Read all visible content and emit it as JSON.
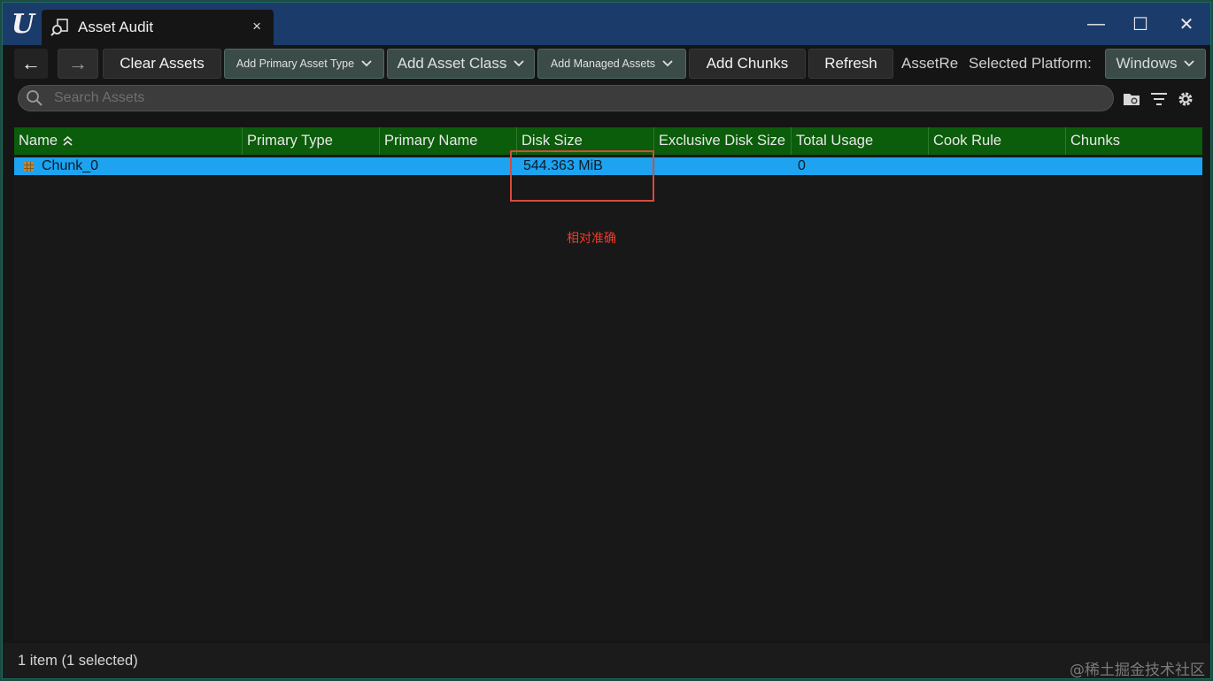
{
  "window": {
    "tab_title": "Asset Audit",
    "tab_close": "×",
    "controls": {
      "minimize": "—",
      "maximize": "☐",
      "close": "✕"
    }
  },
  "toolbar": {
    "back": "←",
    "forward": "→",
    "clear_assets": "Clear Assets",
    "add_primary_asset_type": "Add Primary Asset Type",
    "add_asset_class": "Add Asset Class",
    "add_managed_assets": "Add Managed Assets",
    "add_chunks": "Add Chunks",
    "refresh": "Refresh",
    "asset_registry_truncated": "AssetRe",
    "selected_platform_label": "Selected Platform:",
    "platform_value": "Windows"
  },
  "search": {
    "placeholder": "Search Assets",
    "value": ""
  },
  "table": {
    "columns": [
      "Name",
      "Primary Type",
      "Primary Name",
      "Disk Size",
      "Exclusive Disk Size",
      "Total Usage",
      "Cook Rule",
      "Chunks"
    ],
    "rows": [
      {
        "name": "Chunk_0",
        "primary_type": "",
        "primary_name": "",
        "disk_size": "544.363 MiB",
        "exclusive_disk_size": "",
        "total_usage": "0",
        "cook_rule": "",
        "chunks": ""
      }
    ]
  },
  "annotation": {
    "text": "相对准确",
    "color": "#ef3b2a"
  },
  "status": {
    "text": "1 item (1 selected)"
  },
  "watermark": "@稀土掘金技术社区",
  "colors": {
    "header_bg": "#0b5c0b",
    "selected_row": "#1da3ef",
    "titlebar": "#1b3c6b",
    "window_border": "#1e4a44"
  }
}
